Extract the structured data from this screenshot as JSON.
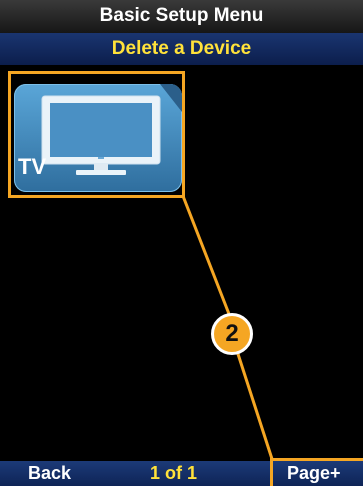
{
  "header": {
    "title": "Basic Setup Menu",
    "subtitle": "Delete a Device"
  },
  "devices": [
    {
      "label": "TV",
      "icon": "tv-icon"
    }
  ],
  "annotation": {
    "step": "2",
    "color": "#f5a623"
  },
  "footer": {
    "back_label": "Back",
    "page_count": "1 of 1",
    "page_next_label": "Page+"
  },
  "colors": {
    "title_text": "#ffffff",
    "subtitle_text": "#ffe23a",
    "tile_blue": "#4b93c7",
    "footer_bg": "#1c3a78"
  }
}
